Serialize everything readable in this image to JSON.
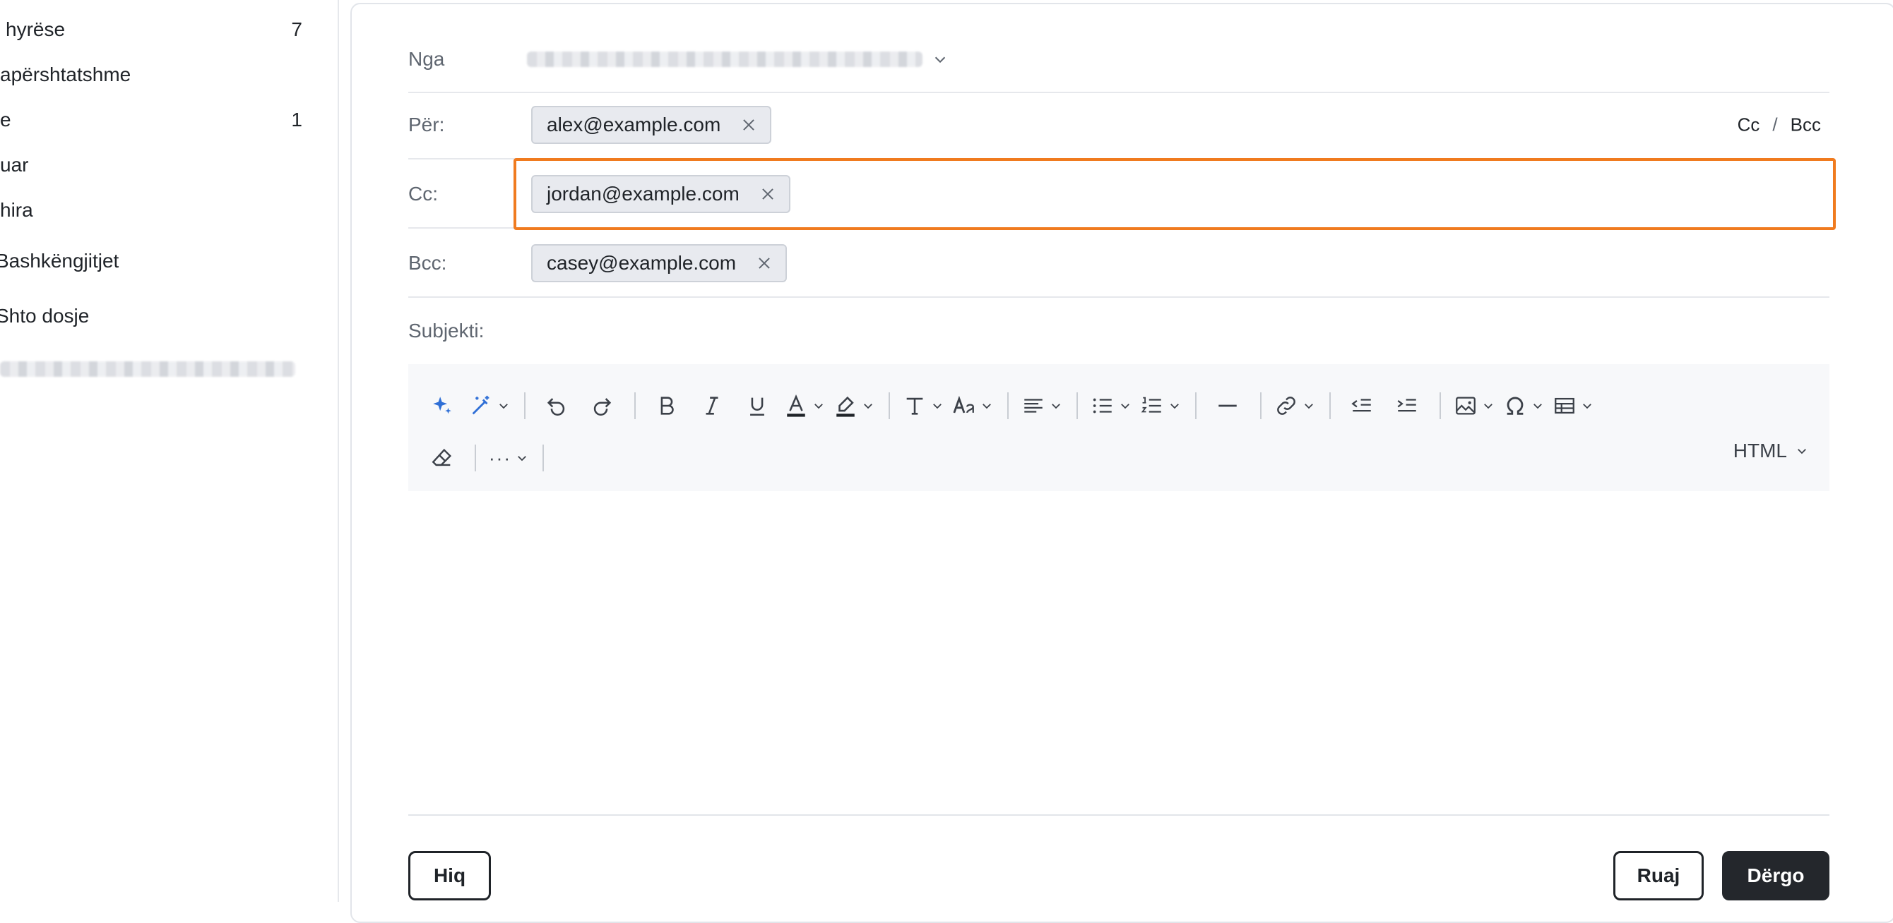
{
  "sidebar": {
    "items": [
      {
        "label": "hyrëse",
        "count": "7"
      },
      {
        "label": "apërshtatshme",
        "count": ""
      },
      {
        "label": "e",
        "count": "1"
      },
      {
        "label": "uar",
        "count": ""
      },
      {
        "label": "hira",
        "count": ""
      },
      {
        "label": "Bashkëngjitjet",
        "count": ""
      },
      {
        "label": "Shto dosje",
        "count": ""
      }
    ]
  },
  "compose": {
    "from_label": "Nga",
    "to_label": "Për:",
    "cc_label": "Cc:",
    "bcc_label": "Bcc:",
    "subject_label": "Subjekti:",
    "to_chips": [
      "alex@example.com"
    ],
    "cc_chips": [
      "jordan@example.com"
    ],
    "bcc_chips": [
      "casey@example.com"
    ],
    "cc_toggle": "Cc",
    "toggle_sep": "/",
    "bcc_toggle": "Bcc"
  },
  "toolbar": {
    "html_mode": "HTML",
    "more": "···",
    "icons": [
      "ai-sparkle-icon",
      "magic-wand-icon",
      "undo-icon",
      "redo-icon",
      "bold-icon",
      "italic-icon",
      "underline-icon",
      "text-color-icon",
      "highlight-icon",
      "font-size-icon",
      "font-family-icon",
      "align-icon",
      "bullet-list-icon",
      "numbered-list-icon",
      "horizontal-rule-icon",
      "link-icon",
      "outdent-icon",
      "indent-icon",
      "image-icon",
      "special-char-icon",
      "table-icon",
      "eraser-icon"
    ]
  },
  "footer": {
    "discard_label": "Hiq",
    "save_label": "Ruaj",
    "send_label": "Dërgo"
  },
  "colors": {
    "highlight": "#f07b1f",
    "send_bg": "#24272c",
    "chip_bg": "#e8eaef",
    "ai_blue": "#2f6fd6"
  }
}
